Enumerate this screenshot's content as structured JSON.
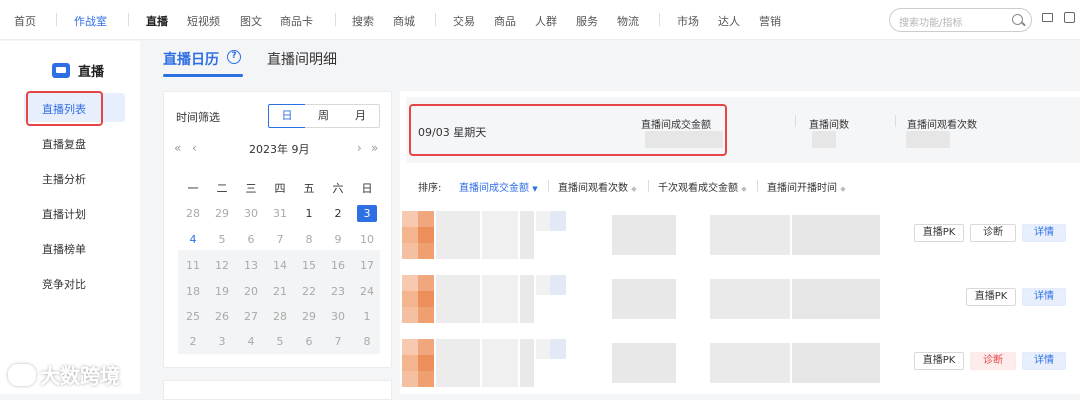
{
  "topnav": {
    "items": [
      "首页",
      "作战室",
      "直播",
      "短视频",
      "图文",
      "商品卡",
      "搜索",
      "商城",
      "交易",
      "商品",
      "人群",
      "服务",
      "物流",
      "市场",
      "达人",
      "营销"
    ],
    "active": "作战室",
    "current": "直播"
  },
  "search": {
    "placeholder": "搜索功能/指标"
  },
  "sidebar": {
    "title": "直播",
    "items": [
      "直播列表",
      "直播复盘",
      "主播分析",
      "直播计划",
      "直播榜单",
      "竞争对比"
    ]
  },
  "tabs": {
    "primary": "直播日历",
    "secondary": "直播间明细",
    "help": "?"
  },
  "calendar": {
    "filter_label": "时间筛选",
    "granularity": [
      "日",
      "周",
      "月"
    ],
    "selected_granularity": "日",
    "month_label": "2023年  9月",
    "nav": {
      "prev_year": "«",
      "prev_month": "‹",
      "next_month": "›",
      "next_year": "»"
    },
    "weekdays": [
      "一",
      "二",
      "三",
      "四",
      "五",
      "六",
      "日"
    ],
    "days": [
      [
        "28",
        "29",
        "30",
        "31",
        "1",
        "2",
        "3"
      ],
      [
        "4",
        "5",
        "6",
        "7",
        "8",
        "9",
        "10"
      ],
      [
        "11",
        "12",
        "13",
        "14",
        "15",
        "16",
        "17"
      ],
      [
        "18",
        "19",
        "20",
        "21",
        "22",
        "23",
        "24"
      ],
      [
        "25",
        "26",
        "27",
        "28",
        "29",
        "30",
        "1"
      ],
      [
        "2",
        "3",
        "4",
        "5",
        "6",
        "7",
        "8"
      ]
    ],
    "selected_day": "3",
    "today": "4"
  },
  "summary": {
    "date": "09/03  星期天",
    "metrics": [
      "直播间成交金额",
      "直播间数",
      "直播间观看次数"
    ]
  },
  "sort": {
    "label": "排序:",
    "options": [
      "直播间成交金额",
      "直播间观看次数",
      "千次观看成交金额",
      "直播间开播时间"
    ],
    "active": "直播间成交金额"
  },
  "rows": [
    {
      "actions": [
        "直播PK",
        "诊断",
        "详情"
      ]
    },
    {
      "actions": [
        "直播PK",
        "详情"
      ]
    },
    {
      "actions": [
        "直播PK",
        "诊断",
        "详情"
      ]
    }
  ],
  "watermark": {
    "text": "大数跨境"
  },
  "colors": {
    "accent": "#2f6fe4",
    "highlight": "#e64545"
  }
}
